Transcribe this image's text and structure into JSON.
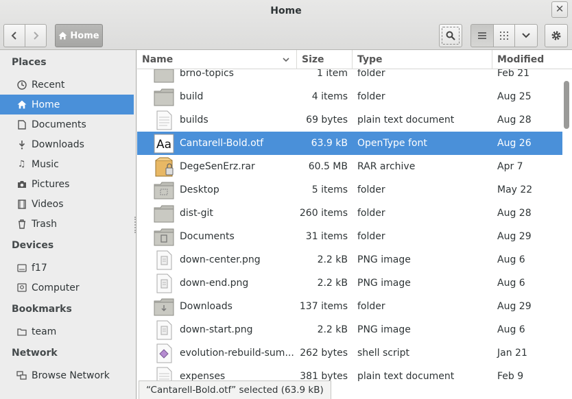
{
  "window": {
    "title": "Home"
  },
  "toolbar": {
    "path_home_label": "Home"
  },
  "sidebar": {
    "sections": [
      {
        "label": "Places"
      },
      {
        "label": "Devices"
      },
      {
        "label": "Bookmarks"
      },
      {
        "label": "Network"
      }
    ],
    "items": [
      {
        "label": "Recent",
        "icon": "clock-icon"
      },
      {
        "label": "Home",
        "icon": "home-icon",
        "selected": true
      },
      {
        "label": "Documents",
        "icon": "document-icon"
      },
      {
        "label": "Downloads",
        "icon": "download-icon"
      },
      {
        "label": "Music",
        "icon": "music-icon"
      },
      {
        "label": "Pictures",
        "icon": "camera-icon"
      },
      {
        "label": "Videos",
        "icon": "film-icon"
      },
      {
        "label": "Trash",
        "icon": "trash-icon"
      },
      {
        "label": "f17",
        "icon": "drive-icon"
      },
      {
        "label": "Computer",
        "icon": "computer-icon"
      },
      {
        "label": "team",
        "icon": "folder-icon"
      },
      {
        "label": "Browse Network",
        "icon": "network-icon"
      }
    ]
  },
  "columns": {
    "name": "Name",
    "size": "Size",
    "type": "Type",
    "modified": "Modified"
  },
  "files": [
    {
      "name": "brno-topics",
      "size": "1 item",
      "type": "folder",
      "modified": "Feb 21",
      "icon": "folder-icon"
    },
    {
      "name": "build",
      "size": "4 items",
      "type": "folder",
      "modified": "Aug 25",
      "icon": "folder-icon"
    },
    {
      "name": "builds",
      "size": "69 bytes",
      "type": "plain text document",
      "modified": "Aug 28",
      "icon": "text-file-icon"
    },
    {
      "name": "Cantarell-Bold.otf",
      "size": "63.9 kB",
      "type": "OpenType font",
      "modified": "Aug 26",
      "icon": "font-file-icon",
      "selected": true
    },
    {
      "name": "DegeSenErz.rar",
      "size": "60.5 MB",
      "type": "RAR archive",
      "modified": "Apr 7",
      "icon": "archive-icon"
    },
    {
      "name": "Desktop",
      "size": "5 items",
      "type": "folder",
      "modified": "May 22",
      "icon": "desktop-folder-icon"
    },
    {
      "name": "dist-git",
      "size": "260 items",
      "type": "folder",
      "modified": "Aug 28",
      "icon": "folder-icon"
    },
    {
      "name": "Documents",
      "size": "31 items",
      "type": "folder",
      "modified": "Aug 29",
      "icon": "documents-folder-icon"
    },
    {
      "name": "down-center.png",
      "size": "2.2 kB",
      "type": "PNG image",
      "modified": "Aug 6",
      "icon": "image-file-icon"
    },
    {
      "name": "down-end.png",
      "size": "2.2 kB",
      "type": "PNG image",
      "modified": "Aug 6",
      "icon": "image-file-icon"
    },
    {
      "name": "Downloads",
      "size": "137 items",
      "type": "folder",
      "modified": "Aug 29",
      "icon": "downloads-folder-icon"
    },
    {
      "name": "down-start.png",
      "size": "2.2 kB",
      "type": "PNG image",
      "modified": "Aug 6",
      "icon": "image-file-icon"
    },
    {
      "name": "evolution-rebuild-sum...",
      "size": "262 bytes",
      "type": "shell script",
      "modified": "Jan 21",
      "icon": "script-file-icon"
    },
    {
      "name": "expenses",
      "size": "381 bytes",
      "type": "plain text document",
      "modified": "Feb 9",
      "icon": "text-file-icon"
    }
  ],
  "status": {
    "text": "“Cantarell-Bold.otf” selected (63.9 kB)"
  }
}
